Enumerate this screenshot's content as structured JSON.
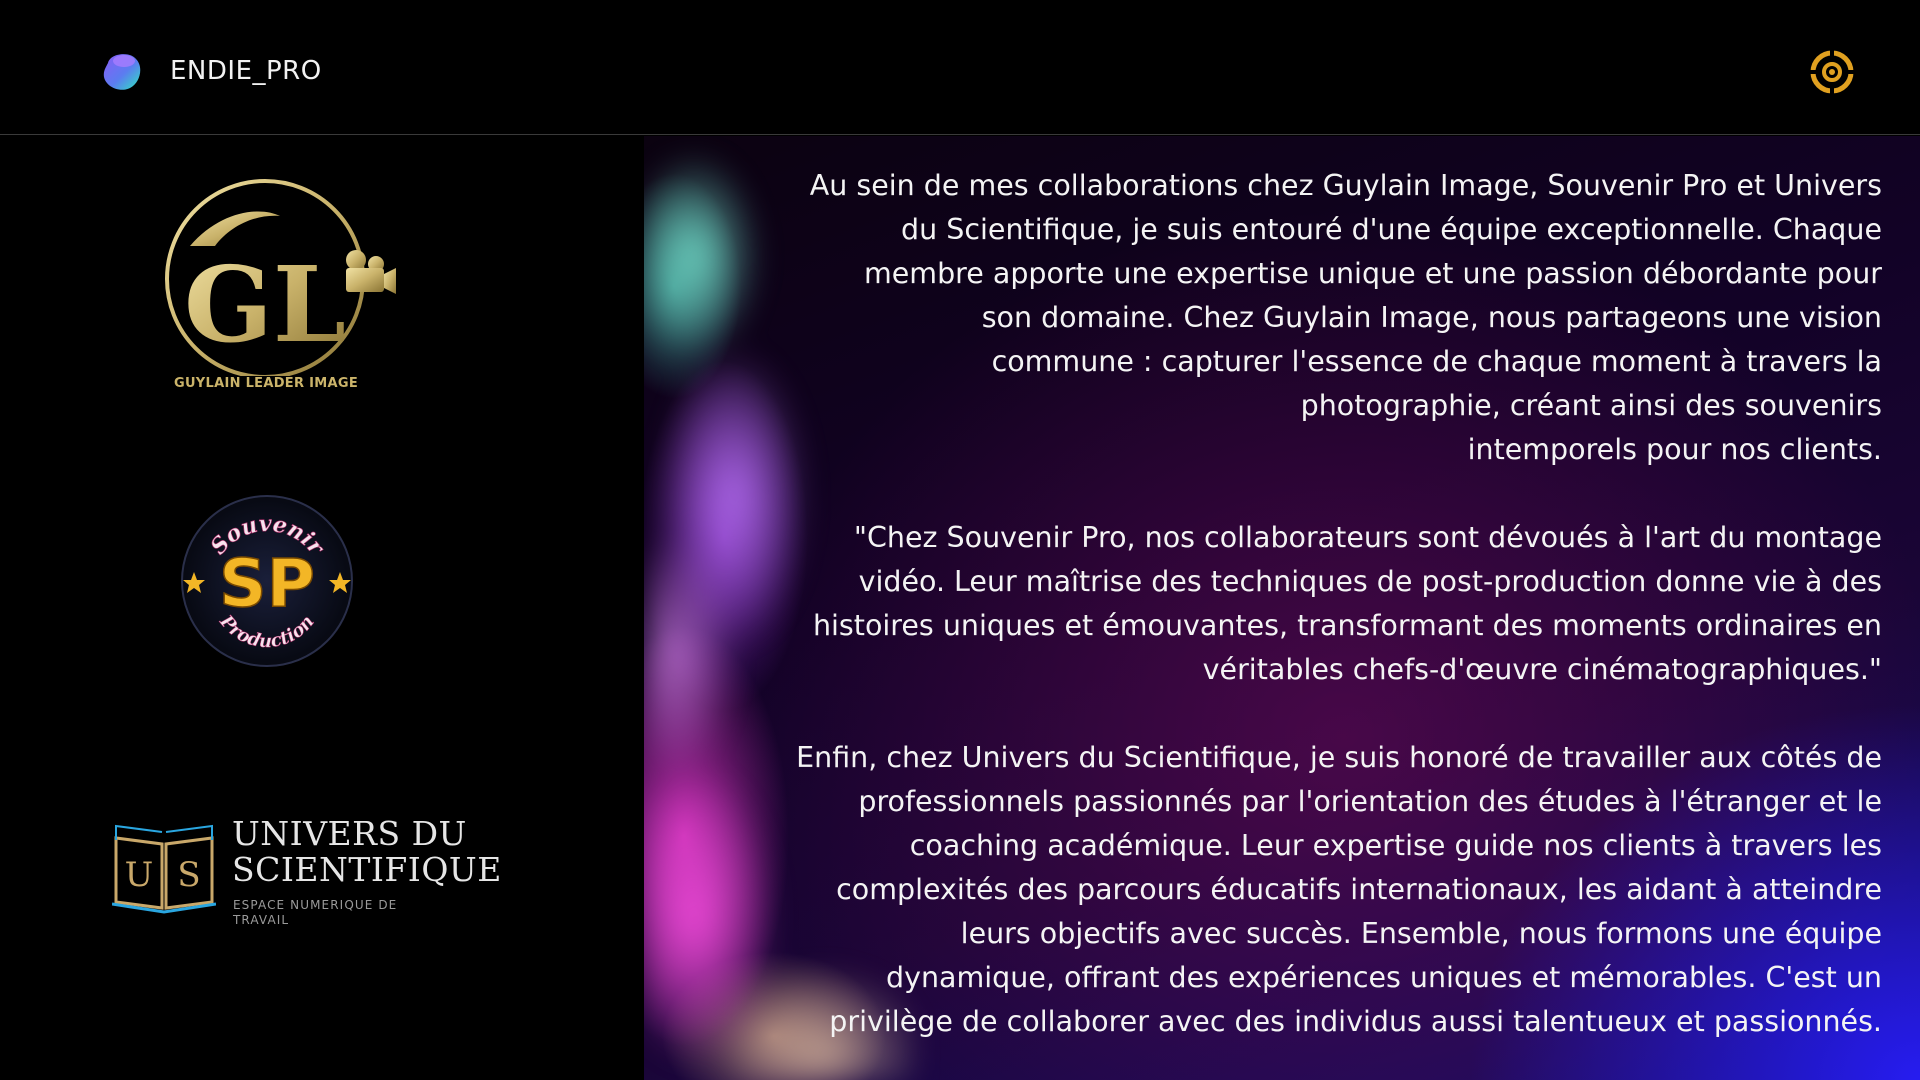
{
  "header": {
    "brand_name": "ENDIE_PRO",
    "brand_logo_icon": "blob-logo-icon",
    "settings_icon": "gear-icon"
  },
  "partners": [
    {
      "id": "guylain",
      "monogram": "GL",
      "caption": "GUYLAIN LEADER IMAGE",
      "icon": "camera-icon",
      "color": "#c9b26a"
    },
    {
      "id": "souvenir",
      "top_text": "Souvenir",
      "monogram": "SP",
      "bottom_text": "Production",
      "color": "#f3b626"
    },
    {
      "id": "univers",
      "monogram_left": "U",
      "monogram_right": "S",
      "title_line1": "UNIVERS DU",
      "title_line2": "SCIENTIFIQUE",
      "subtitle": "ESPACE NUMERIQUE DE TRAVAIL",
      "color": "#c9a86a"
    }
  ],
  "content": {
    "paragraphs": [
      "Au sein de mes collaborations chez Guylain Image, Souvenir Pro et Univers\ndu Scientifique, je suis entouré d'une équipe exceptionnelle. Chaque\nmembre apporte une expertise unique et une passion débordante pour\nson domaine. Chez Guylain Image, nous partageons une vision \ncommune : capturer l'essence de chaque moment à travers la\nphotographie, créant ainsi des souvenirs \nintemporels pour nos clients.",
      "\"Chez Souvenir Pro, nos collaborateurs sont dévoués à l'art du montage\nvidéo. Leur maîtrise des techniques de post-production donne vie à des\nhistoires uniques et émouvantes, transformant des moments ordinaires en\nvéritables chefs-d'œuvre cinématographiques.\"",
      "Enfin, chez Univers du Scientifique, je suis honoré de travailler aux côtés de\nprofessionnels passionnés par l'orientation des études à l'étranger et le\ncoaching académique. Leur expertise guide nos clients à travers les\ncomplexités des parcours éducatifs internationaux, les aidant à atteindre\nleurs objectifs avec succès. Ensemble, nous formons une équipe\ndynamique, offrant des expériences uniques et mémorables. C'est un\nprivilège de collaborer avec des individus aussi talentueux et passionnés."
    ]
  }
}
